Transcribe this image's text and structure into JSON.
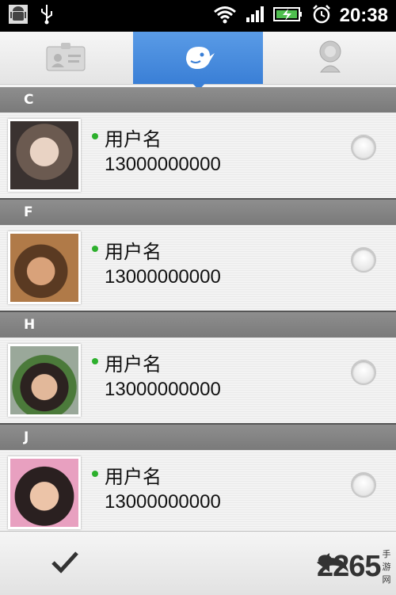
{
  "statusbar": {
    "time": "20:38"
  },
  "tabs": [
    {
      "icon": "contact-card-icon"
    },
    {
      "icon": "bird-icon"
    },
    {
      "icon": "person-icon"
    }
  ],
  "contacts": [
    {
      "section": "C",
      "name": "用户名",
      "phone": "13000000000",
      "avatar": "avatar-photo"
    },
    {
      "section": "F",
      "name": "用户名",
      "phone": "13000000000",
      "avatar": "avatar-photo"
    },
    {
      "section": "H",
      "name": "用户名",
      "phone": "13000000000",
      "avatar": "avatar-photo"
    },
    {
      "section": "J",
      "name": "用户名",
      "phone": "13000000000",
      "avatar": "avatar-photo"
    }
  ],
  "bottombar": {
    "confirm_icon": "checkmark-icon",
    "back_icon": "back-arrow-icon"
  },
  "watermark": {
    "big": "2265",
    "small": "手游网"
  },
  "colors": {
    "accent": "#3a7fd6",
    "online_dot": "#2db02d",
    "section_header": "#808080"
  }
}
